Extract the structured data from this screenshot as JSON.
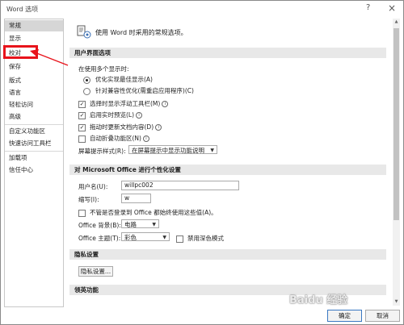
{
  "window": {
    "title": "Word 选项",
    "help": "?",
    "close": "×"
  },
  "sidebar": {
    "items": [
      {
        "label": "常规"
      },
      {
        "label": "显示"
      },
      {
        "label": "校对"
      },
      {
        "label": "保存"
      },
      {
        "label": "版式"
      },
      {
        "label": "语言"
      },
      {
        "label": "轻松访问"
      },
      {
        "label": "高级"
      },
      {
        "label": "自定义功能区"
      },
      {
        "label": "快速访问工具栏"
      },
      {
        "label": "加载项"
      },
      {
        "label": "信任中心"
      }
    ]
  },
  "content": {
    "header": "使用 Word 时采用的常规选项。",
    "ui_section": "用户界面选项",
    "multi_display_label": "在使用多个显示时:",
    "radio_optimize": "优化实现最佳显示(A)",
    "radio_compat": "针对兼容性优化(需重启应用程序)(C)",
    "cb_mini_toolbar": "选择时显示浮动工具栏(M)",
    "cb_live_preview": "启用实时预览(L)",
    "cb_update_drag": "拖动时更新文档内容(D)",
    "cb_collapse_ribbon": "自动折叠功能区(N)",
    "tooltip_label": "屏幕提示样式(R):",
    "tooltip_value": "在屏幕提示中显示功能说明",
    "personalize_section": "对 Microsoft Office 进行个性化设置",
    "username_label": "用户名(U):",
    "username_value": "willpc002",
    "initials_label": "缩写(I):",
    "initials_value": "w",
    "cb_always_use": "不管是否登录到 Office 都始终使用这些值(A)。",
    "background_label": "Office 背景(B):",
    "background_value": "电路",
    "theme_label": "Office 主题(T):",
    "theme_value": "彩色",
    "cb_dark_mode": "禁用深色模式",
    "privacy_section": "隐私设置",
    "privacy_button": "隐私设置...",
    "startup_section": "领英功能"
  },
  "footer": {
    "ok": "确定",
    "cancel": "取消"
  },
  "watermark": "Baidu 经验"
}
